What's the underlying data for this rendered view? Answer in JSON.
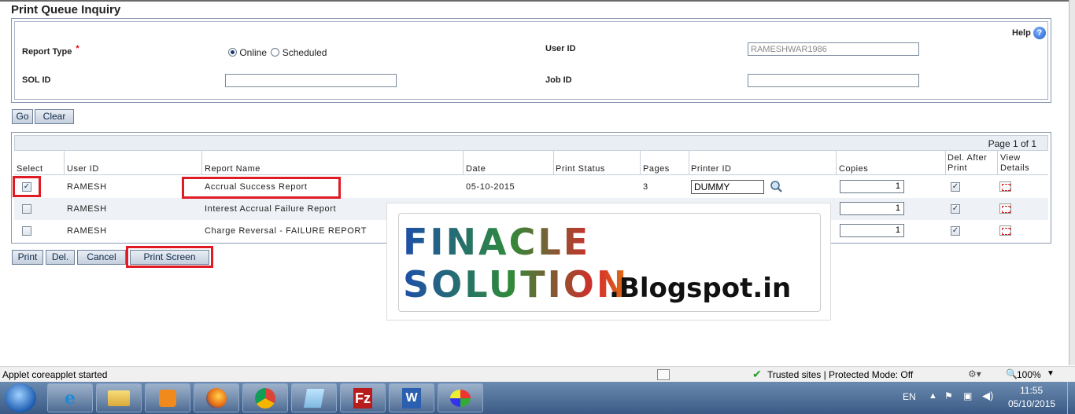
{
  "page": {
    "title": "Print Queue Inquiry"
  },
  "form": {
    "help_label": "Help",
    "report_type_label": "Report Type",
    "required_mark": "*",
    "radio_online": "Online",
    "radio_scheduled": "Scheduled",
    "selected_report_type": "Online",
    "user_id_label": "User ID",
    "user_id_value": "RAMESHWAR1986",
    "sol_id_label": "SOL ID",
    "sol_id_value": "",
    "job_id_label": "Job ID",
    "job_id_value": ""
  },
  "actions": {
    "go": "Go",
    "clear": "Clear"
  },
  "grid": {
    "page_info": "Page  1 of 1",
    "columns": {
      "select": "Select",
      "user_id": "User ID",
      "report_name": "Report Name",
      "date": "Date",
      "print_status": "Print Status",
      "pages": "Pages",
      "printer_id": "Printer ID",
      "copies": "Copies",
      "del_after_print_1": "Del. After",
      "del_after_print_2": "Print",
      "view_details_1": "View",
      "view_details_2": "Details"
    },
    "rows": [
      {
        "selected": true,
        "user_id": "RAMESH",
        "report_name": "Accrual Success Report",
        "date": "05-10-2015",
        "print_status": "",
        "pages": "3",
        "printer_id": "DUMMY",
        "copies": "1",
        "del_after_print": true
      },
      {
        "selected": false,
        "user_id": "RAMESH",
        "report_name": "Interest Accrual Failure Report",
        "date": "",
        "print_status": "",
        "pages": "",
        "printer_id": "",
        "copies": "1",
        "del_after_print": true
      },
      {
        "selected": false,
        "user_id": "RAMESH",
        "report_name": "Charge Reversal - FAILURE REPORT",
        "date": "",
        "print_status": "",
        "pages": "",
        "printer_id": "",
        "copies": "1",
        "del_after_print": true
      }
    ]
  },
  "bottom_actions": {
    "print": "Print",
    "delete": "Del.",
    "cancel": "Cancel",
    "print_screen": "Print Screen"
  },
  "watermark": {
    "line1": "FINACLE SOLUTION",
    "line2": ".Blogspot.in"
  },
  "statusbar": {
    "message": "Applet coreapplet started",
    "zone": "Trusted sites | Protected Mode: Off",
    "zoom": "100%"
  },
  "taskbar": {
    "apps": [
      "start-orb",
      "internet-explorer",
      "file-explorer",
      "media-player",
      "firefox",
      "chrome",
      "notepad",
      "filezilla",
      "word",
      "paint"
    ],
    "language": "EN",
    "time": "11:55",
    "date": "05/10/2015"
  },
  "colors": {
    "accent": "#e01b24",
    "button_border": "#6b7f99",
    "taskbar": "#3a5a85"
  }
}
